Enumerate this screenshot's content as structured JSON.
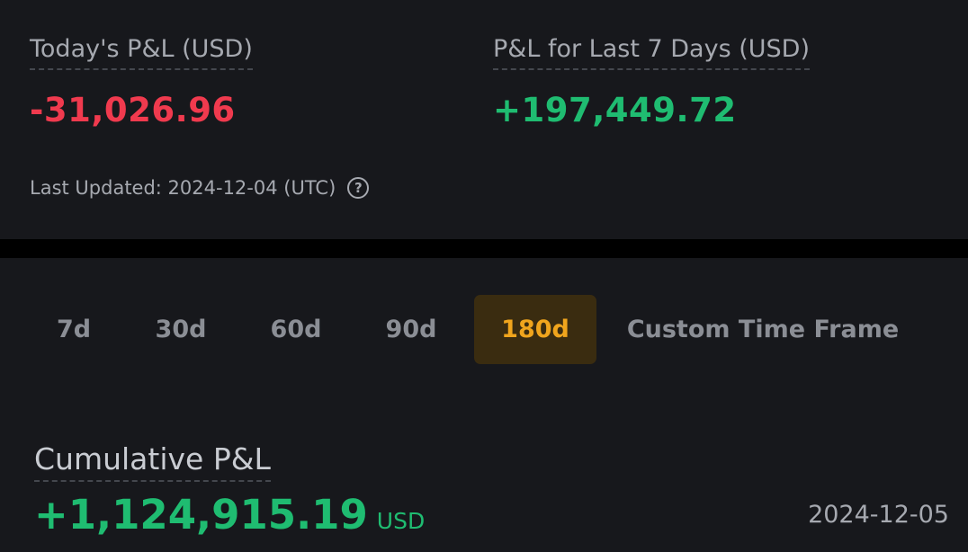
{
  "today_pnl": {
    "label": "Today's P&L (USD)",
    "value": "-31,026.96",
    "color": "#f03a4e"
  },
  "week_pnl": {
    "label": "P&L for Last 7 Days (USD)",
    "value": "+197,449.72",
    "color": "#1fbc71"
  },
  "last_updated": {
    "text": "Last Updated: 2024-12-04 (UTC)",
    "help_icon": "question-circle-icon",
    "help_glyph": "?"
  },
  "range_tabs": {
    "items": [
      {
        "label": "7d",
        "selected": false
      },
      {
        "label": "30d",
        "selected": false
      },
      {
        "label": "60d",
        "selected": false
      },
      {
        "label": "90d",
        "selected": false
      },
      {
        "label": "180d",
        "selected": true
      },
      {
        "label": "Custom Time Frame",
        "selected": false
      }
    ],
    "accent_color": "#f0a51d"
  },
  "cumulative": {
    "label": "Cumulative P&L",
    "value": "+1,124,915.19",
    "unit": "USD",
    "date": "2024-12-05"
  }
}
